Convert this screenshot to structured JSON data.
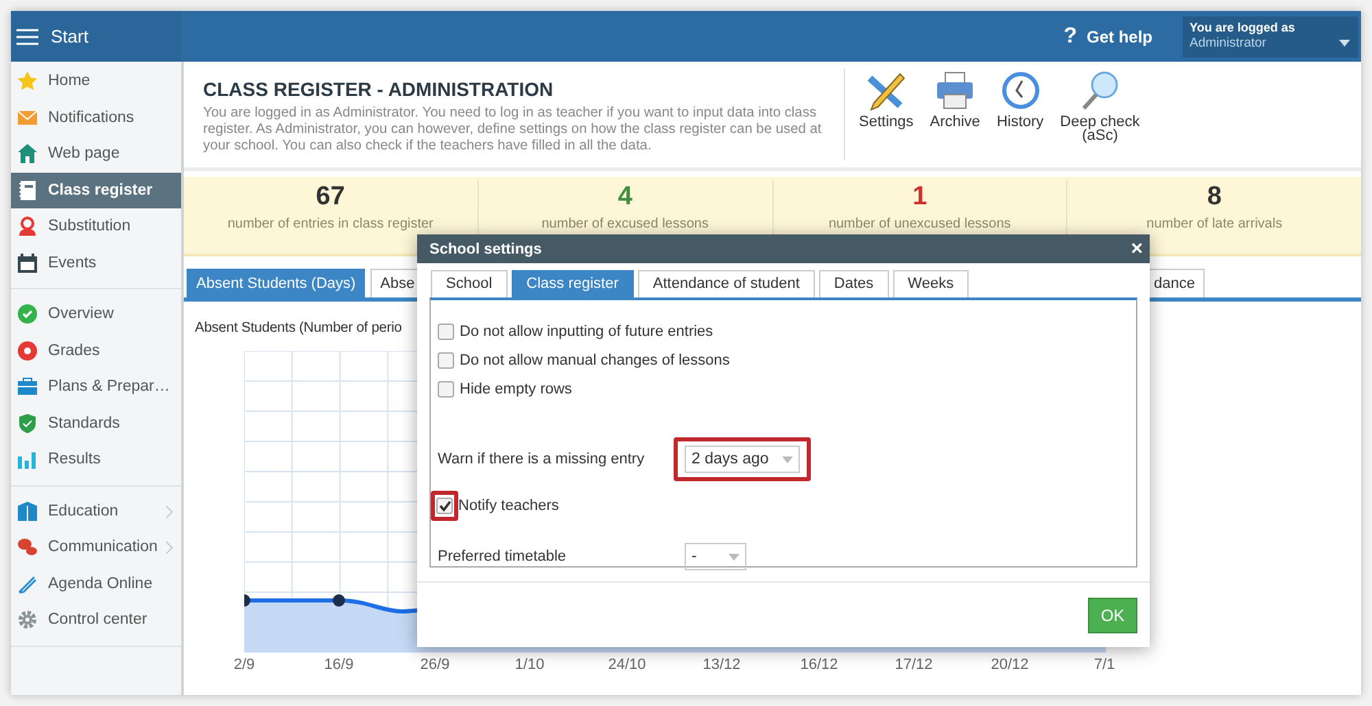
{
  "sidebar": {
    "header": "Start",
    "groups": [
      {
        "items": [
          {
            "label": "Home",
            "selected": false,
            "submenu": false
          },
          {
            "label": "Notifications",
            "selected": false,
            "submenu": false
          },
          {
            "label": "Web page",
            "selected": false,
            "submenu": false
          },
          {
            "label": "Class register",
            "selected": true,
            "submenu": false
          },
          {
            "label": "Substitution",
            "selected": false,
            "submenu": false
          },
          {
            "label": "Events",
            "selected": false,
            "submenu": false
          }
        ]
      },
      {
        "items": [
          {
            "label": "Overview",
            "selected": false,
            "submenu": false
          },
          {
            "label": "Grades",
            "selected": false,
            "submenu": false
          },
          {
            "label": "Plans & Prepar…",
            "selected": false,
            "submenu": false
          },
          {
            "label": "Standards",
            "selected": false,
            "submenu": false
          },
          {
            "label": "Results",
            "selected": false,
            "submenu": false
          }
        ]
      },
      {
        "items": [
          {
            "label": "Education",
            "selected": false,
            "submenu": true
          },
          {
            "label": "Communication",
            "selected": false,
            "submenu": true
          },
          {
            "label": "Agenda Online",
            "selected": false,
            "submenu": false
          },
          {
            "label": "Control center",
            "selected": false,
            "submenu": false
          }
        ]
      }
    ]
  },
  "top_bar": {
    "help": "Get help",
    "help_icon": "?",
    "user_caption": "You are logged as",
    "user_name": "Administrator"
  },
  "header": {
    "title": "CLASS REGISTER - ADMINISTRATION",
    "description": "You are logged in as Administrator. You need to log in as teacher if you want to input data into class register. As Administrator, you can however, define settings on how the class register can be used at your school. You can also check if the teachers have filled in all the data."
  },
  "toolbar": [
    {
      "label": "Settings",
      "kind": "settings"
    },
    {
      "label": "Archive",
      "kind": "archive"
    },
    {
      "label": "History",
      "kind": "history"
    },
    {
      "label": "Deep check\n(aSc)",
      "kind": "search"
    }
  ],
  "stats": [
    {
      "value": "67",
      "label": "number of entries in class register",
      "color": "#333333"
    },
    {
      "value": "4",
      "label": "number of excused lessons",
      "color": "#3f8f3f"
    },
    {
      "value": "1",
      "label": "number of unexcused lessons",
      "color": "#d32f2f"
    },
    {
      "value": "8",
      "label": "number of late arrivals",
      "color": "#333333"
    }
  ],
  "tabs": [
    {
      "label": "Absent Students (Days)",
      "selected": true
    },
    {
      "label": "Abse",
      "selected": false
    },
    {
      "label": "dance",
      "selected": false
    }
  ],
  "chart": {
    "title": "Absent Students (Number of perio",
    "x_labels": [
      "2/9",
      "16/9",
      "26/9",
      "1/10",
      "24/10",
      "13/12",
      "16/12",
      "17/12",
      "20/12",
      "7/1"
    ]
  },
  "dialog": {
    "title": "School settings",
    "close": "×",
    "tabs": [
      {
        "label": "School",
        "selected": false
      },
      {
        "label": "Class register",
        "selected": true
      },
      {
        "label": "Attendance of student",
        "selected": false
      },
      {
        "label": "Dates",
        "selected": false
      },
      {
        "label": "Weeks",
        "selected": false
      }
    ],
    "options": [
      {
        "label": "Do not allow inputting of future entries",
        "checked": false
      },
      {
        "label": "Do not allow manual changes of lessons",
        "checked": false
      },
      {
        "label": "Hide empty rows",
        "checked": false
      }
    ],
    "warn": {
      "label": "Warn if there is a missing entry",
      "value": "2 days ago",
      "highlighted": true
    },
    "notify": {
      "label": "Notify teachers",
      "checked": true,
      "highlighted": true
    },
    "timetable": {
      "label": "Preferred timetable",
      "value": "-",
      "highlighted": false
    },
    "ok": "OK"
  }
}
